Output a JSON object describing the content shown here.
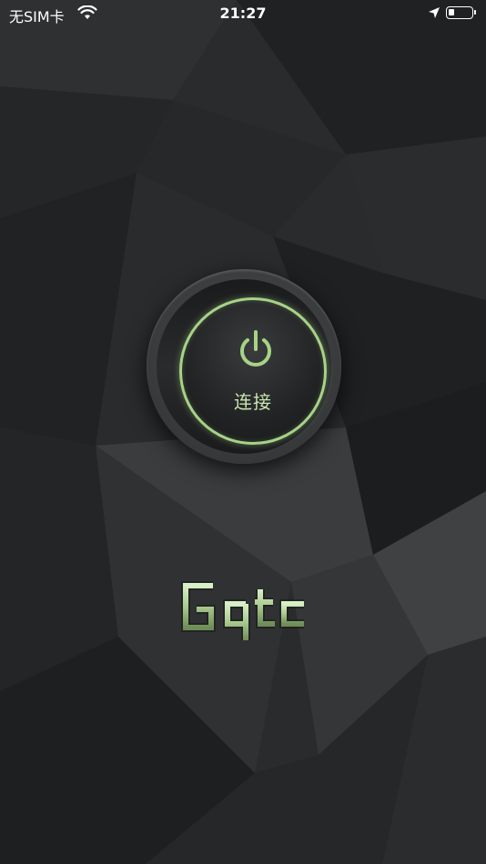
{
  "status_bar": {
    "carrier": "无SIM卡",
    "time": "21:27",
    "battery_level": 0.25
  },
  "connect_button": {
    "label": "连接",
    "icon": "power-icon"
  },
  "logo": {
    "text": "Gqtc"
  },
  "colors": {
    "background": "#262829",
    "accent_green": "#a6d387",
    "label_green": "#c9e6b0"
  }
}
